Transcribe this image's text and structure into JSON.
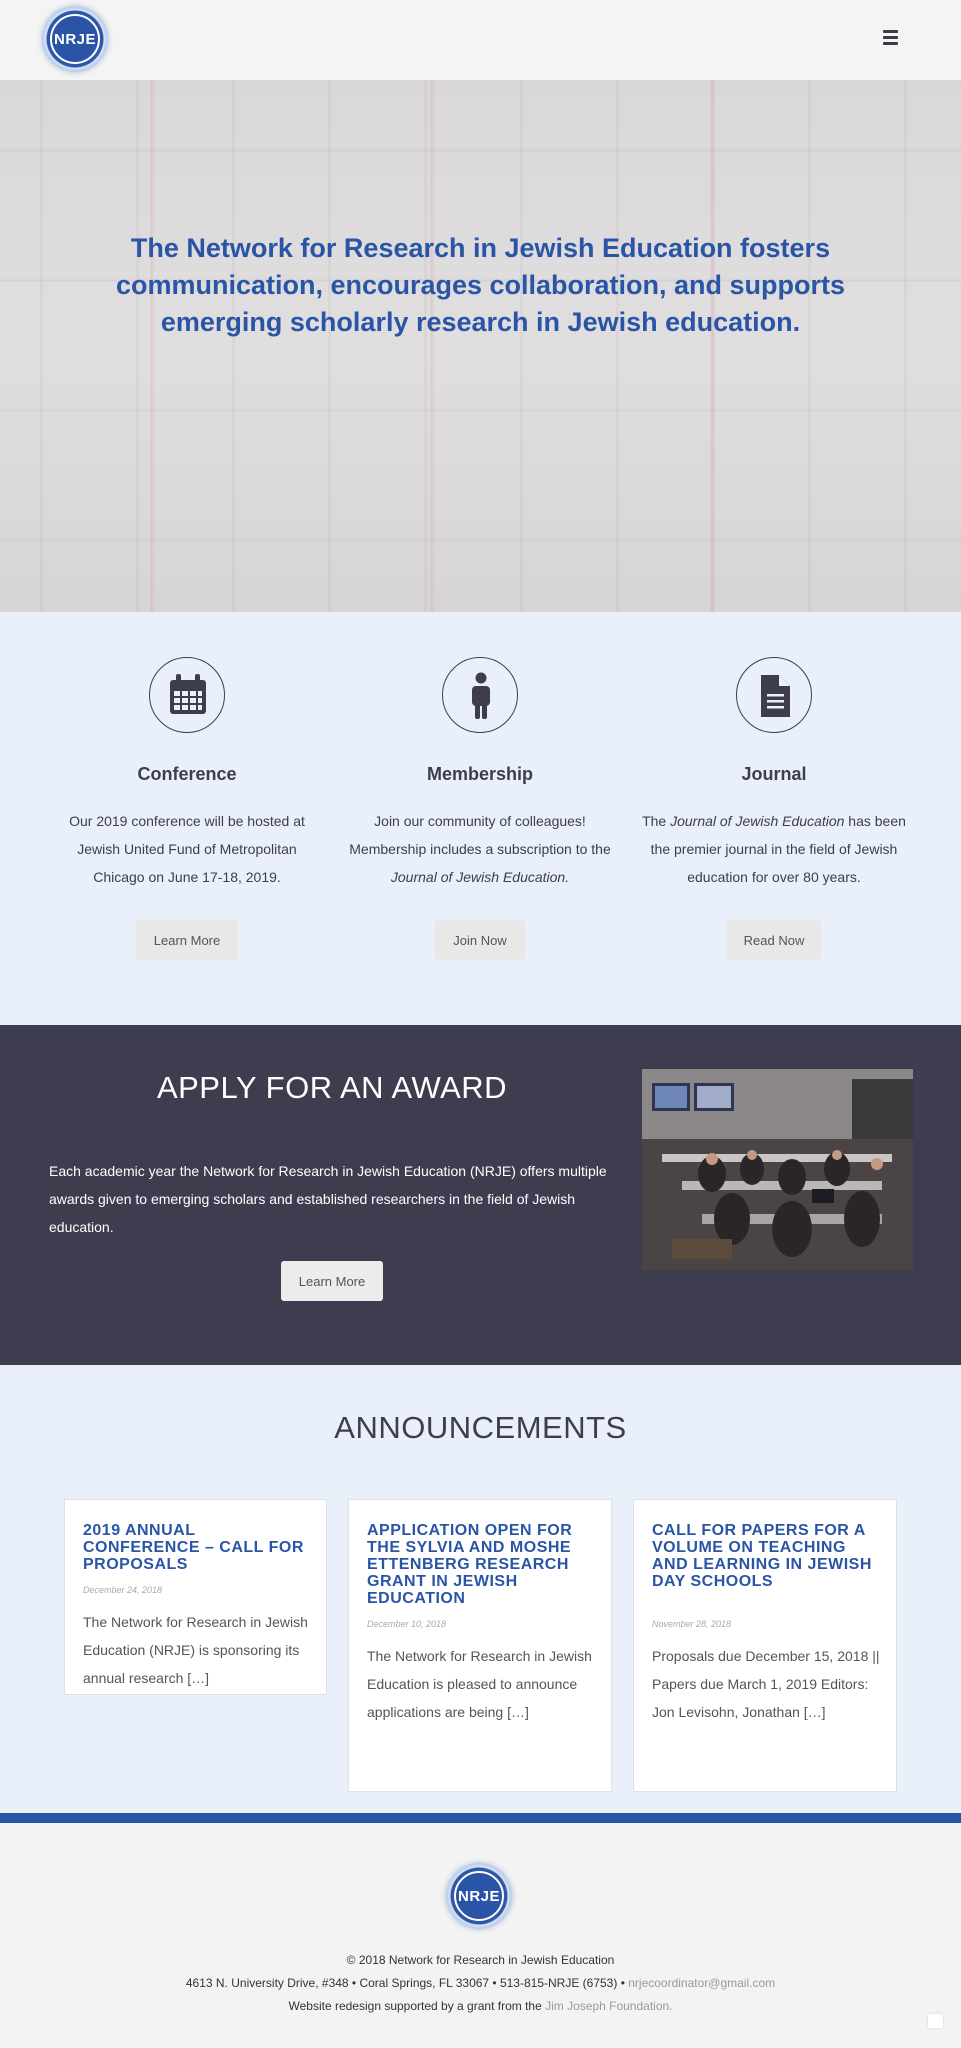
{
  "header": {
    "logo_text": "NRJE",
    "menu_icon": "hamburger-menu-icon"
  },
  "hero": {
    "text": "The Network for Research in Jewish Education fosters communication, encourages collaboration, and supports emerging scholarly research in Jewish education."
  },
  "features": [
    {
      "icon": "calendar-icon",
      "title": "Conference",
      "text": "Our 2019 conference will be hosted at Jewish United Fund of Metropolitan Chicago on June 17-18, 2019.",
      "button": "Learn More"
    },
    {
      "icon": "person-icon",
      "title": "Membership",
      "text_before": "Join our community of colleagues! Membership includes a subscription to the ",
      "text_italic": "Journal of Jewish Education.",
      "button": "Join Now"
    },
    {
      "icon": "document-icon",
      "title": "Journal",
      "text_before": "The ",
      "text_italic": "Journal of Jewish Education",
      "text_after": " has been the premier journal in the field of Jewish education for over 80 years.",
      "button": "Read Now"
    }
  ],
  "award": {
    "title": "APPLY FOR AN AWARD",
    "text": "Each academic year the Network for Research in Jewish Education (NRJE) offers multiple awards given to emerging scholars and established researchers in the field of Jewish education.",
    "button": "Learn More"
  },
  "announcements": {
    "title": "ANNOUNCEMENTS",
    "items": [
      {
        "title": "2019 ANNUAL CONFERENCE – CALL FOR PROPOSALS",
        "date": "December 24, 2018",
        "excerpt": "The Network for Research in Jewish Education (NRJE) is sponsoring its annual research […]"
      },
      {
        "title": "APPLICATION OPEN FOR THE SYLVIA AND MOSHE ETTENBERG RESEARCH GRANT IN JEWISH EDUCATION",
        "date": "December 10, 2018",
        "excerpt": "The Network for Research in Jewish Education is pleased to announce applications are being […]"
      },
      {
        "title": "CALL FOR PAPERS FOR A VOLUME ON TEACHING AND LEARNING IN JEWISH DAY SCHOOLS",
        "date": "November 28, 2018",
        "excerpt": "Proposals due December 15, 2018 || Papers due March 1, 2019 Editors: Jon Levisohn, Jonathan […]"
      }
    ]
  },
  "footer": {
    "logo_text": "NRJE",
    "copyright": "© 2018 Network for Research in Jewish Education",
    "address": "4613 N. University Drive, #348 • Coral Springs, FL 33067 • 513-815-NRJE (6753) • ",
    "email": "nrjecoordinator@gmail.com",
    "grant_text": "Website redesign supported by a grant from the ",
    "grant_link": "Jim Joseph Foundation."
  },
  "colors": {
    "brand_blue": "#2a55a6",
    "dark_section": "#3e3d50",
    "light_section": "#eaf0f9"
  }
}
